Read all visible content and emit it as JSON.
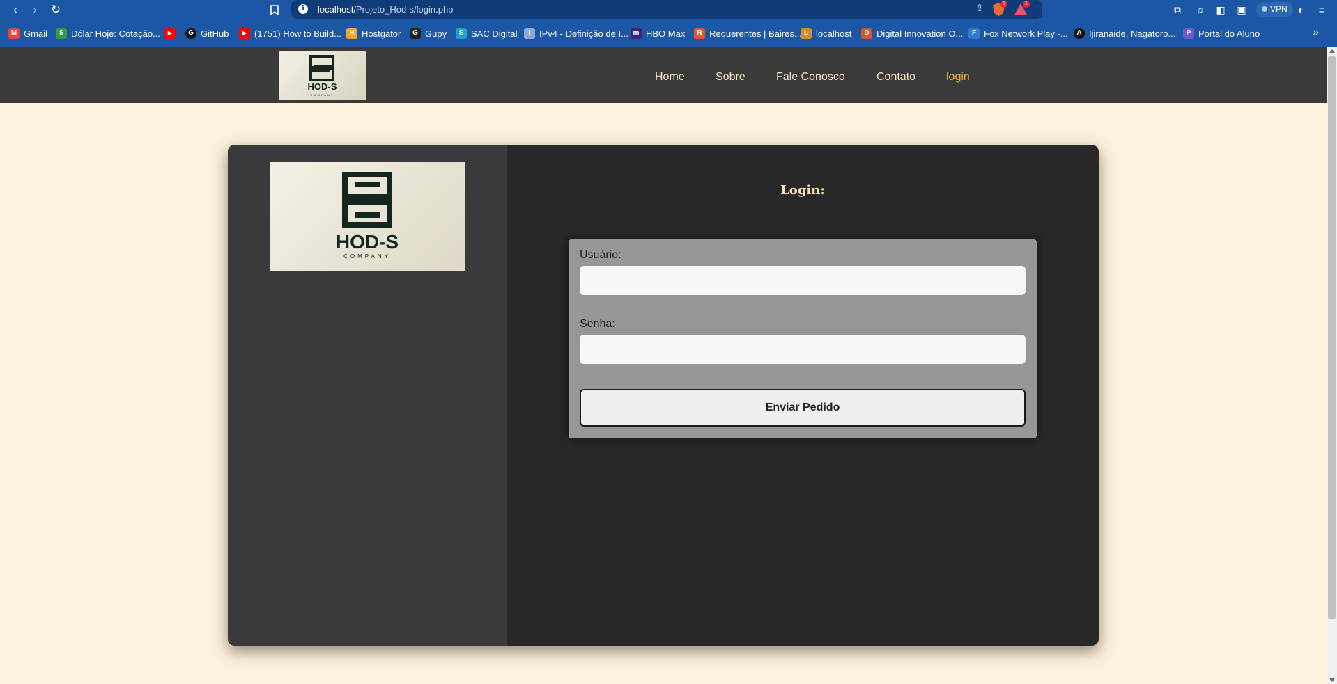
{
  "browser": {
    "url_host": "localhost",
    "url_path": "/Projeto_Hod-s/login.php",
    "vpn_label": "VPN",
    "brave_badge": "1",
    "rewards_badge": "1",
    "bookmarks": [
      {
        "label": "Gmail",
        "color": "#ea4335",
        "glyph": "M"
      },
      {
        "label": "Dólar Hoje: Cotação...",
        "color": "#2e9e44",
        "glyph": "$"
      },
      {
        "label": "",
        "color": "#ff0000",
        "glyph": "▶"
      },
      {
        "label": "GitHub",
        "color": "#111111",
        "glyph": "G"
      },
      {
        "label": "(1751) How to Build...",
        "color": "#ff0000",
        "glyph": "▶"
      },
      {
        "label": "Hostgator",
        "color": "#f5a623",
        "glyph": "H"
      },
      {
        "label": "Gupy",
        "color": "#222222",
        "glyph": "G"
      },
      {
        "label": "SAC Digital",
        "color": "#1fa3c8",
        "glyph": "S"
      },
      {
        "label": "IPv4 - Definição de I...",
        "color": "#8ba9d6",
        "glyph": "I"
      },
      {
        "label": "HBO Max",
        "color": "#3b2378",
        "glyph": "m"
      },
      {
        "label": "Requerentes | Baires...",
        "color": "#e8562a",
        "glyph": "R"
      },
      {
        "label": "localhost",
        "color": "#d68a2b",
        "glyph": "L"
      },
      {
        "label": "Digital Innovation O...",
        "color": "#d2552b",
        "glyph": "D"
      },
      {
        "label": "Fox Network Play -...",
        "color": "#2e7dd1",
        "glyph": "F"
      },
      {
        "label": "Ijiranaide, Nagatoro...",
        "color": "#111111",
        "glyph": "A"
      },
      {
        "label": "Portal do Aluno",
        "color": "#6a5acd",
        "glyph": "P"
      }
    ]
  },
  "site": {
    "brand_name": "HOD-S",
    "brand_sub": "COMPANY",
    "menu": [
      {
        "label": "Home"
      },
      {
        "label": "Sobre"
      },
      {
        "label": "Fale Conosco"
      },
      {
        "label": "Contato"
      },
      {
        "label": "login"
      }
    ]
  },
  "login": {
    "title": "Login:",
    "username_label": "Usuário:",
    "username_value": "",
    "password_label": "Senha:",
    "password_value": "",
    "submit_label": "Enviar Pedido"
  },
  "colors": {
    "page_bg": "#fdf1dc",
    "header_bg": "#3a3a3a",
    "menu_text": "#f7e4c2",
    "menu_active": "#f0a93b",
    "card_bg": "#282828",
    "form_bg": "#979797"
  }
}
